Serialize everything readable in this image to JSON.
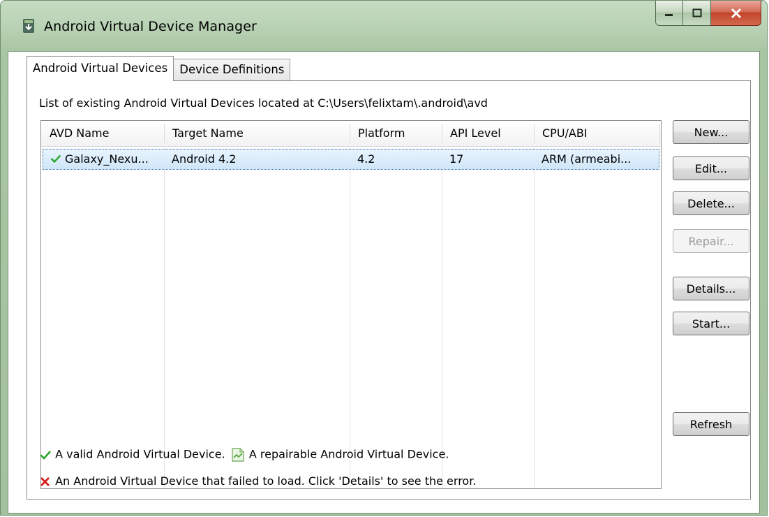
{
  "window": {
    "title": "Android Virtual Device Manager",
    "caption_buttons": [
      "minimize",
      "maximize",
      "close"
    ]
  },
  "tabs": [
    {
      "label": "Android Virtual Devices",
      "active": true
    },
    {
      "label": "Device Definitions",
      "active": false
    }
  ],
  "description": "List of existing Android Virtual Devices located at C:\\Users\\felixtam\\.android\\avd",
  "table": {
    "columns": [
      "AVD Name",
      "Target Name",
      "Platform",
      "API Level",
      "CPU/ABI"
    ],
    "rows": [
      {
        "status_icon": "valid-check-icon",
        "avd_name": "Galaxy_Nexu...",
        "target_name": "Android 4.2",
        "platform": "4.2",
        "api_level": "17",
        "cpu_abi": "ARM (armeabi...",
        "selected": true
      }
    ]
  },
  "buttons": {
    "new": "New...",
    "edit": "Edit...",
    "delete": "Delete...",
    "repair": "Repair...",
    "details": "Details...",
    "start": "Start...",
    "refresh": "Refresh"
  },
  "legend": {
    "valid": "A valid Android Virtual Device.",
    "repairable": "A repairable Android Virtual Device.",
    "failed": "An Android Virtual Device that failed to load. Click 'Details' to see the error."
  },
  "colors": {
    "valid_check": "#2aa52a",
    "failed_x": "#d42020",
    "selection": "#cfe6f8",
    "titlebar": "#b8d1b3"
  }
}
